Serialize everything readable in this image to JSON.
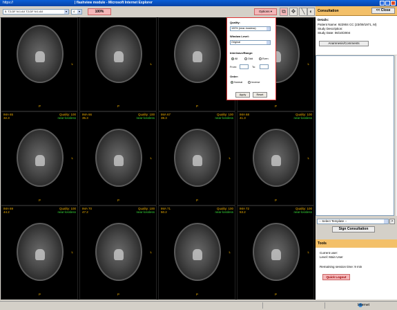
{
  "window": {
    "url": "https://",
    "title": "| flashview module - Microsoft Internet Explorer"
  },
  "toolbar": {
    "series_select": "5. T2-DF N:1 AX T2-DF N:1 AX",
    "count_select": "4",
    "zoom": "100%",
    "options_label": "Options ▾"
  },
  "images": [
    {
      "ima": "",
      "pos": "",
      "quality": "",
      "q2": ""
    },
    {
      "ima": "",
      "pos": "",
      "quality": "",
      "q2": ""
    },
    {
      "ima": "",
      "pos": "",
      "quality": "",
      "q2": ""
    },
    {
      "ima": "",
      "pos": "",
      "quality": "",
      "q2": ""
    },
    {
      "ima": "IMA 65",
      "pos": "32.3",
      "quality": "Quality: 100",
      "q2": "near-lossless"
    },
    {
      "ima": "IMA 66",
      "pos": "35.3",
      "quality": "Quality: 100",
      "q2": "near-lossless"
    },
    {
      "ima": "IMA 67",
      "pos": "38.3",
      "quality": "Quality: 100",
      "q2": "near-lossless"
    },
    {
      "ima": "IMA 68",
      "pos": "41.3",
      "quality": "Quality: 100",
      "q2": "near-lossless"
    },
    {
      "ima": "IMA 69",
      "pos": "44.2",
      "quality": "Quality: 100",
      "q2": "near-lossless"
    },
    {
      "ima": "IMA 70",
      "pos": "47.2",
      "quality": "Quality: 100",
      "q2": "near-lossless"
    },
    {
      "ima": "IMA 71",
      "pos": "50.2",
      "quality": "Quality: 100",
      "q2": "near-lossless"
    },
    {
      "ima": "IMA 72",
      "pos": "53.2",
      "quality": "Quality: 100",
      "q2": "near-lossless"
    }
  ],
  "orientation": {
    "posterior": "P",
    "left": "L"
  },
  "options": {
    "quality_label": "Quality:",
    "quality_value": "100% (near-lossless)",
    "window_label": "Window Level:",
    "window_value": "Original",
    "interleave_label": "Interleave/Range:",
    "all": "All",
    "odd": "Odd",
    "even": "Even",
    "from": "From:",
    "to": "To:",
    "order_label": "Order:",
    "normal": "Normal",
    "inverse": "Inverse",
    "apply": "Apply",
    "reset": "Reset"
  },
  "consultation": {
    "title": "Consultation",
    "close": "<< Close",
    "details_label": "Details:",
    "patient": "Patient Name: 922904 CC (23/09/1971, M)",
    "description": "Study Description:",
    "date": "Study Date: 06/10/2004",
    "anamnesis_button": "Anamnesis/Comments",
    "template_select": "-- Select Template --",
    "template_go": ">",
    "sign_button": "Sign Consultation"
  },
  "tools": {
    "title": "Tools",
    "current_user": "Current user:",
    "level": "Level: Main User",
    "session": "Remaining session time:  9 min",
    "logout": "Quick Logout"
  },
  "statusbar": {
    "zone": "Internet"
  }
}
